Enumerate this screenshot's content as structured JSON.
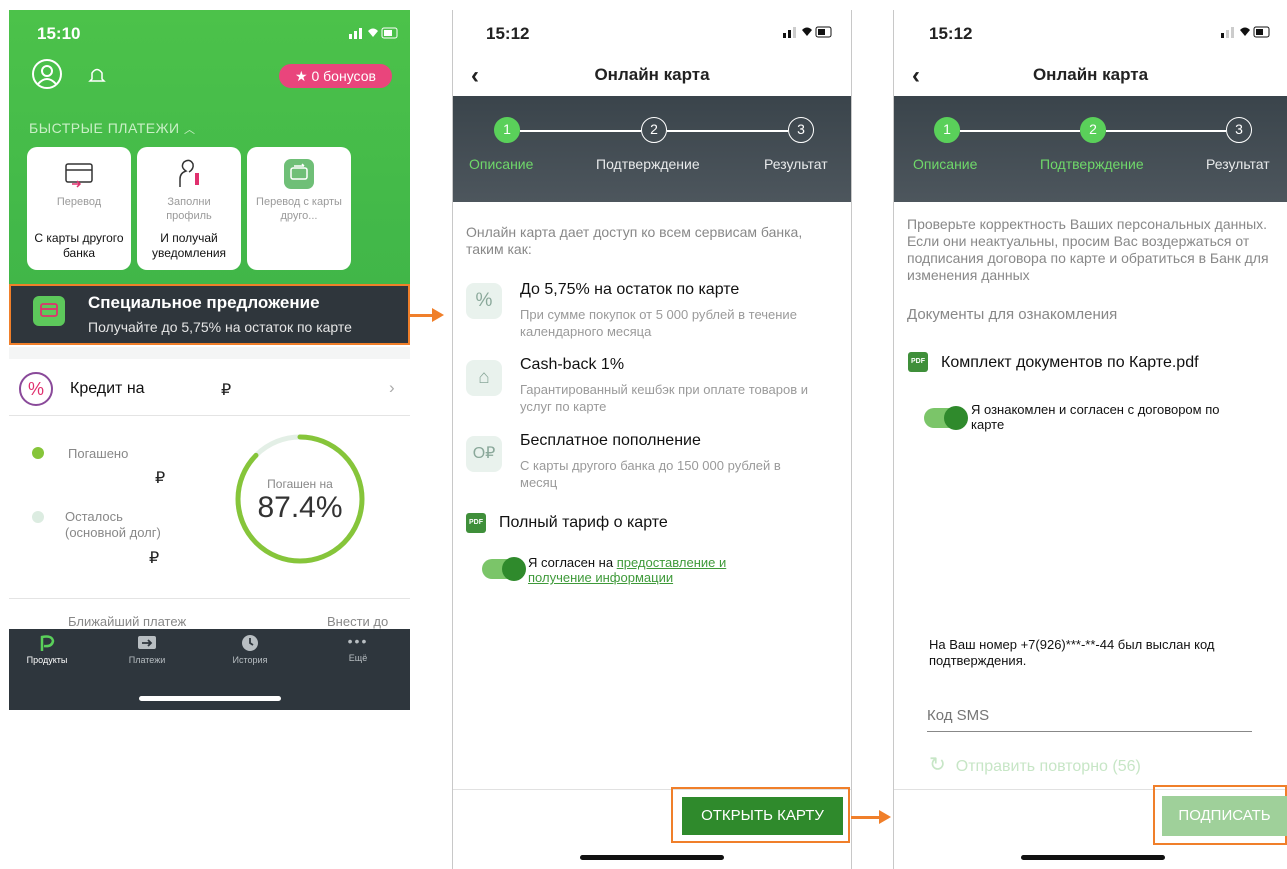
{
  "screen1": {
    "time": "15:10",
    "bonus": "★ 0 бонусов",
    "quick_payments": "БЫСТРЫЕ ПЛАТЕЖИ",
    "tiles": [
      {
        "top": "Перевод",
        "bottom": "С карты другого банка"
      },
      {
        "top": "Заполни профиль",
        "bottom": "И получай уведомления"
      },
      {
        "top": "Перевод с карты друго...",
        "bottom": ""
      }
    ],
    "special_title": "Специальное предложение",
    "special_sub": "Получайте до 5,75% на остаток по карте",
    "credit_label": "Кредит на",
    "ruble": "₽",
    "paid_label": "Погашено",
    "remaining_label": "Осталось (основной долг)",
    "gauge_label": "Погашен на",
    "gauge_value": "87.4%",
    "gauge_fraction": 0.874,
    "next_payment": "Ближайший платеж",
    "pay_by": "Внести до",
    "tabs": [
      "Продукты",
      "Платежи",
      "История",
      "Ещё"
    ]
  },
  "screen2": {
    "time": "15:12",
    "title": "Онлайн карта",
    "steps": [
      "Описание",
      "Подтверждение",
      "Результат"
    ],
    "step_numbers": [
      "1",
      "2",
      "3"
    ],
    "intro": "Онлайн карта дает доступ ко всем сервисам банка, таким как:",
    "features": [
      {
        "icon": "%",
        "title": "До 5,75% на остаток по карте",
        "sub": "При сумме покупок от 5 000 рублей в течение календарного месяца"
      },
      {
        "icon": "⌂",
        "title": "Cash-back 1%",
        "sub": "Гарантированный кешбэк при оплате товаров и услуг по карте"
      },
      {
        "icon": "O₽",
        "title": "Бесплатное пополнение",
        "sub": "С карты другого банка до 150 000 рублей в месяц"
      }
    ],
    "tariff": "Полный тариф о карте",
    "agree_prefix": "Я согласен на ",
    "agree_link": "предоставление и получение информации",
    "button": "ОТКРЫТЬ КАРТУ"
  },
  "screen3": {
    "time": "15:12",
    "title": "Онлайн карта",
    "steps": [
      "Описание",
      "Подтверждение",
      "Результат"
    ],
    "step_numbers": [
      "1",
      "2",
      "3"
    ],
    "intro": "Проверьте корректность Ваших персональных данных. Если они неактуальны, просим Вас воздержаться от подписания договора по карте и обратиться в Банк для изменения данных",
    "docs_heading": "Документы для ознакомления",
    "doc_file": "Комплект документов по Карте.pdf",
    "agree": "Я ознакомлен и согласен с договором по карте",
    "sms_info": "На Ваш номер +7(926)***-**-44 был выслан код подтверждения.",
    "sms_placeholder": "Код SMS",
    "resend": "Отправить повторно (56)",
    "button": "ПОДПИСАТЬ"
  },
  "colors": {
    "accent": "#43b949",
    "arrow": "#f07f2a",
    "dark": "#2e363d",
    "button": "#2f8a2c"
  }
}
